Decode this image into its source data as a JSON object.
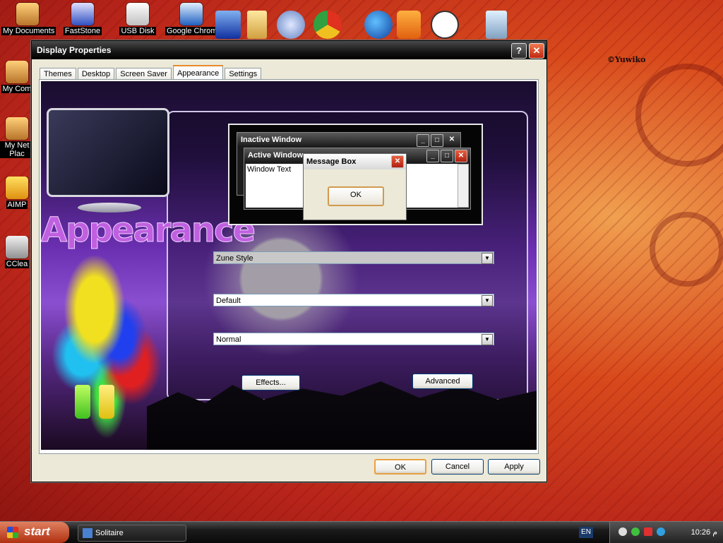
{
  "desktop": {
    "icons": [
      {
        "label": "My Documents"
      },
      {
        "label": "FastStone"
      },
      {
        "label": "USB Disk"
      },
      {
        "label": "Google Chrome"
      },
      {
        "label": "My Com"
      },
      {
        "label": "My Net Plac"
      },
      {
        "label": "AIMP"
      },
      {
        "label": "CClea"
      }
    ],
    "watermark": "©Yuwiko"
  },
  "dialog": {
    "title": "Display Properties",
    "help_button": "?",
    "close_button": "✕",
    "tabs": [
      {
        "label": "Themes",
        "active": false
      },
      {
        "label": "Desktop",
        "active": false
      },
      {
        "label": "Screen Saver",
        "active": false
      },
      {
        "label": "Appearance",
        "active": true
      },
      {
        "label": "Settings",
        "active": false
      }
    ],
    "art_title": "Appearance",
    "preview": {
      "inactive_title": "Inactive Window",
      "active_title": "Active Window",
      "window_text": "Window Text",
      "message_title": "Message Box",
      "message_ok": "OK"
    },
    "color_scheme": {
      "value": "Zune Style"
    },
    "font_size": {
      "value": "Default"
    },
    "third_select": {
      "value": "Normal"
    },
    "effects_button": "Effects...",
    "advanced_button": "Advanced",
    "ok_button": "OK",
    "cancel_button": "Cancel",
    "apply_button": "Apply"
  },
  "taskbar": {
    "start_label": "start",
    "items": [
      {
        "label": "Solitaire"
      }
    ],
    "language": "EN",
    "clock": "10:26 م"
  },
  "colors": {
    "accent": "#e68b2c",
    "title_bar": "#1a1a1a",
    "close_button": "#c02810"
  }
}
